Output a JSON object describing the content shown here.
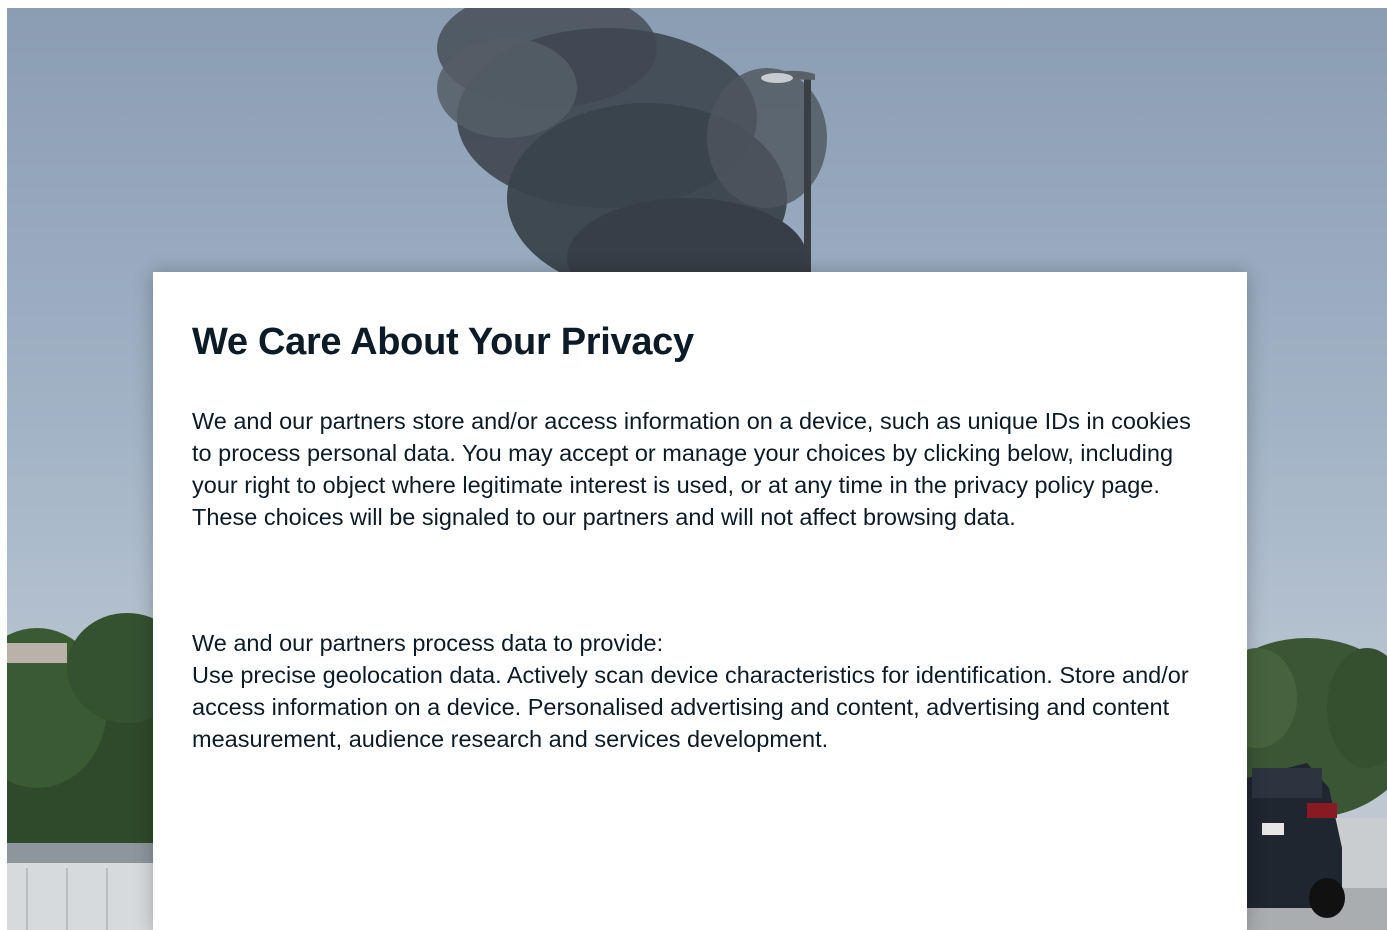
{
  "background": {
    "description_icon": "smoke-plume-photo-icon",
    "sky_color": "#9fb0c3"
  },
  "consent_dialog": {
    "title": "We Care About Your Privacy",
    "intro": "We and our partners store and/or access information on a device, such as unique IDs in cookies to process personal data. You may accept or manage your choices by clicking below, including your right to object where legitimate interest is used, or at any time in the privacy policy page. These choices will be signaled to our partners and will not affect browsing data.",
    "purposes_heading": "We and our partners process data to provide:",
    "purposes_text": "Use precise geolocation data. Actively scan device characteristics for identification. Store and/or access information on a device. Personalised advertising and content, advertising and content measurement, audience research and services development.",
    "text_color": "#0d1b26"
  }
}
